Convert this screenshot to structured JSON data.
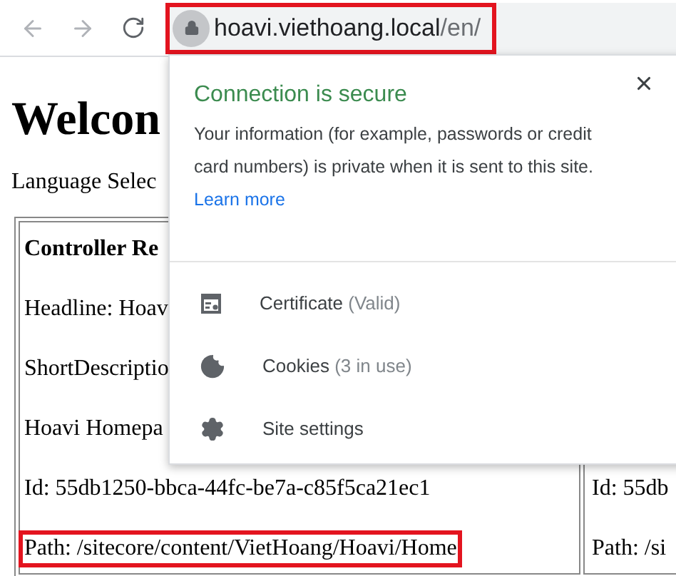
{
  "toolbar": {
    "url_host": "hoavi.viethoang.local",
    "url_path": "/en/",
    "highlighted": true
  },
  "page": {
    "heading": "Welcon",
    "language_label": "Language Selec",
    "column_1": [
      {
        "text": "Controller Re",
        "bold": true,
        "highlighted": false
      },
      {
        "text": "Headline: Hoav",
        "bold": false,
        "highlighted": false
      },
      {
        "text": "ShortDescriptio",
        "bold": false,
        "highlighted": false
      },
      {
        "text": "Hoavi Homepa",
        "bold": false,
        "highlighted": false
      },
      {
        "text": "Id: 55db1250-bbca-44fc-be7a-c85f5ca21ec1",
        "bold": false,
        "highlighted": false
      },
      {
        "text": "Path: /sitecore/content/VietHoang/Hoavi/Home",
        "bold": false,
        "highlighted": true
      }
    ],
    "column_2": [
      "Id: 55db",
      "Path: /si"
    ]
  },
  "popup": {
    "title": "Connection is secure",
    "body": "Your information (for example, passwords or credit card numbers) is private when it is sent to this site.",
    "link": "Learn more",
    "items": [
      {
        "kind": "certificate",
        "label": "Certificate",
        "detail": "(Valid)"
      },
      {
        "kind": "cookies",
        "label": "Cookies",
        "detail": "(3 in use)"
      },
      {
        "kind": "settings",
        "label": "Site settings"
      }
    ]
  }
}
